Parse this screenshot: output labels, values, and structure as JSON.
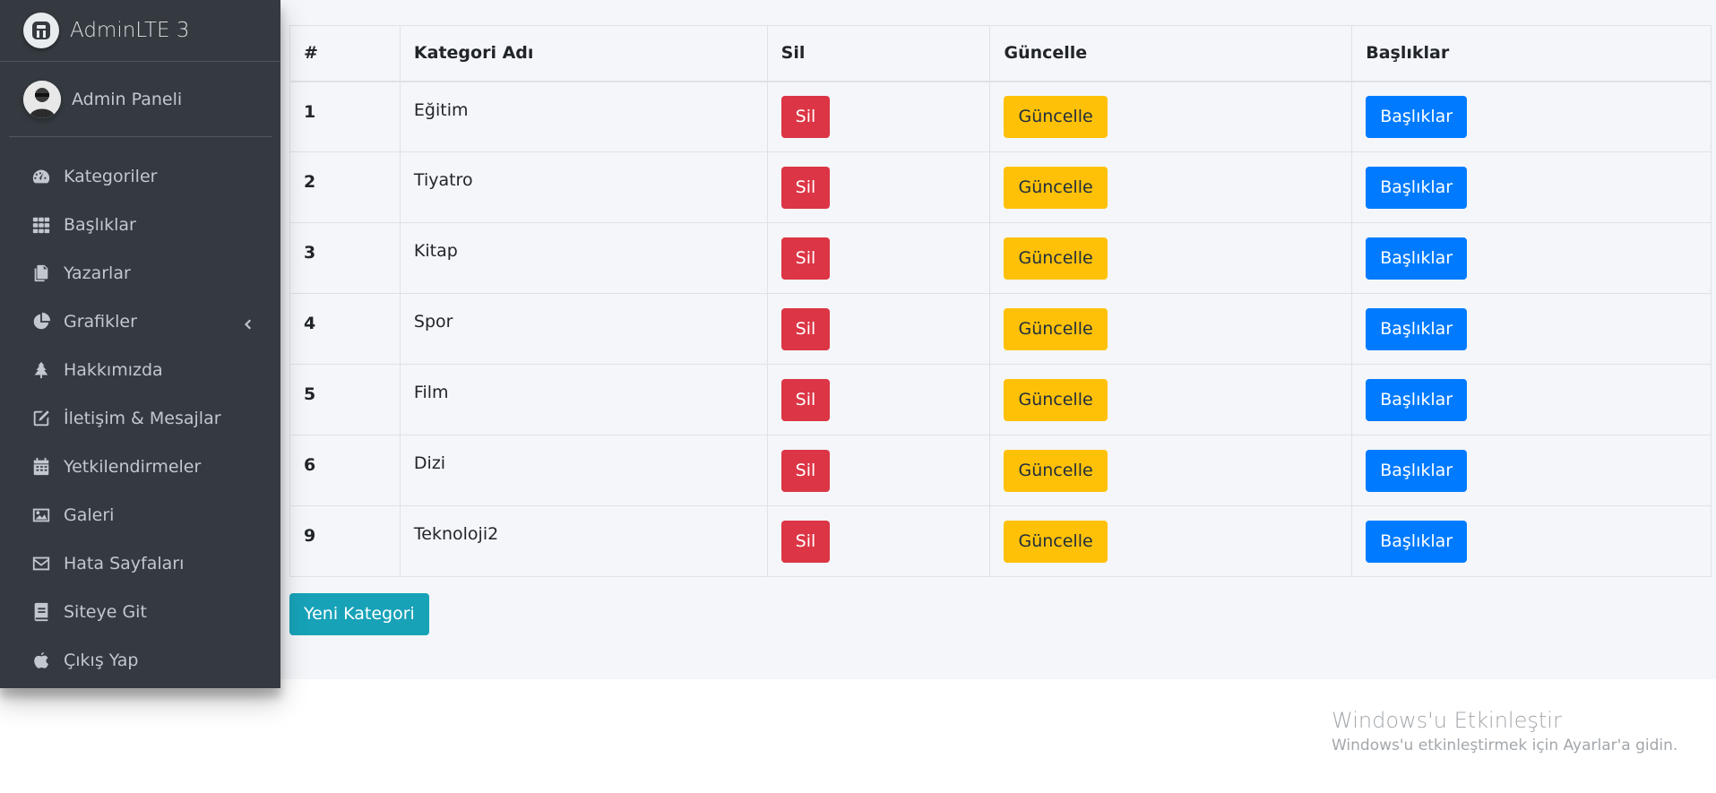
{
  "sidebar": {
    "brand": "AdminLTE 3",
    "user_name": "Admin Paneli",
    "items": [
      {
        "label": "Kategoriler",
        "icon": "tachometer-icon"
      },
      {
        "label": "Başlıklar",
        "icon": "grid-icon"
      },
      {
        "label": "Yazarlar",
        "icon": "copy-icon"
      },
      {
        "label": "Grafikler",
        "icon": "pie-chart-icon",
        "has_children": true
      },
      {
        "label": "Hakkımızda",
        "icon": "tree-icon"
      },
      {
        "label": "İletişim & Mesajlar",
        "icon": "edit-icon"
      },
      {
        "label": "Yetkilendirmeler",
        "icon": "calendar-icon"
      },
      {
        "label": "Galeri",
        "icon": "image-icon"
      },
      {
        "label": "Hata Sayfaları",
        "icon": "envelope-icon"
      },
      {
        "label": "Siteye Git",
        "icon": "book-icon"
      },
      {
        "label": "Çıkış Yap",
        "icon": "apple-icon"
      }
    ]
  },
  "table": {
    "headers": [
      "#",
      "Kategori Adı",
      "Sil",
      "Güncelle",
      "Başlıklar"
    ],
    "rows": [
      {
        "id": "1",
        "name": "Eğitim"
      },
      {
        "id": "2",
        "name": "Tiyatro"
      },
      {
        "id": "3",
        "name": "Kitap"
      },
      {
        "id": "4",
        "name": "Spor"
      },
      {
        "id": "5",
        "name": "Film"
      },
      {
        "id": "6",
        "name": "Dizi"
      },
      {
        "id": "9",
        "name": "Teknoloji2"
      }
    ],
    "delete_label": "Sil",
    "update_label": "Güncelle",
    "titles_label": "Başlıklar"
  },
  "new_category_label": "Yeni Kategori",
  "watermark": {
    "title": "Windows'u Etkinleştir",
    "subtitle": "Windows'u etkinleştirmek için Ayarlar'a gidin."
  },
  "colors": {
    "sidebar_bg": "#343a40",
    "content_bg": "#f4f6f9",
    "danger": "#dc3545",
    "warning": "#ffc107",
    "primary": "#007bff",
    "info": "#17a2b8"
  }
}
